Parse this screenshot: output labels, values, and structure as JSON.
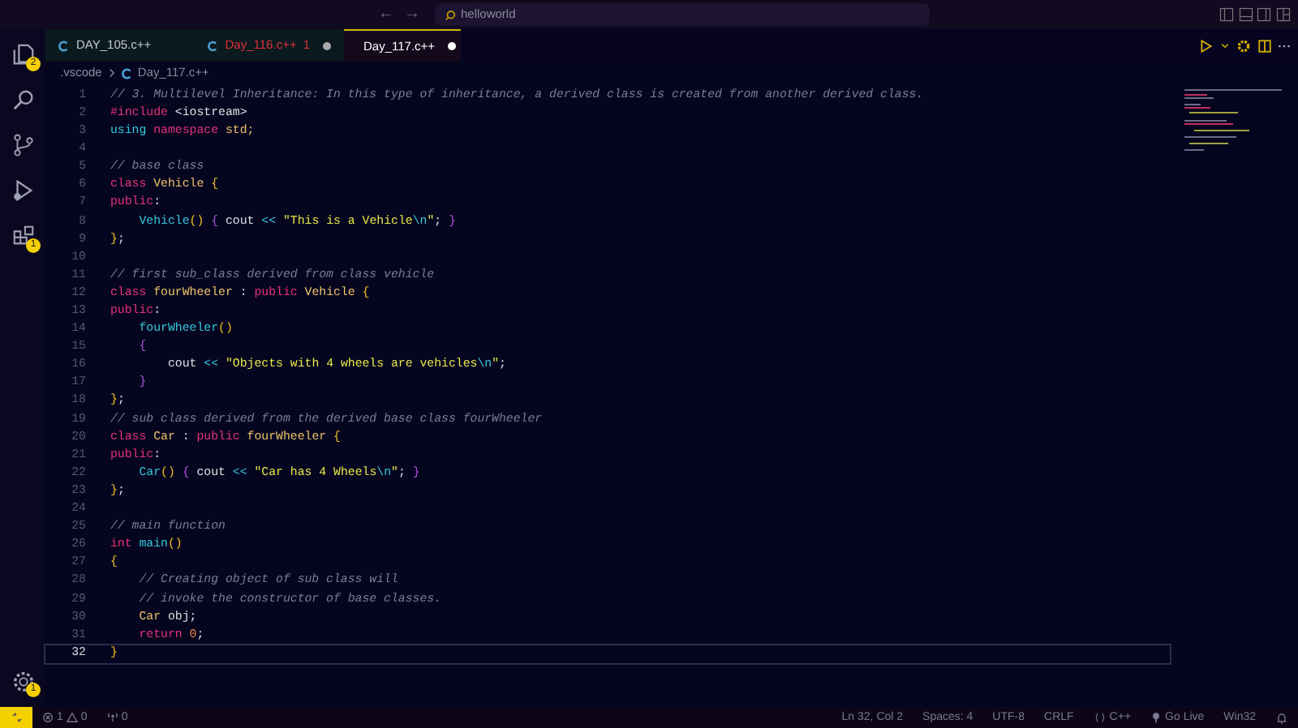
{
  "title_bar": {
    "back": "←",
    "forward": "→",
    "search": "helloworld"
  },
  "activity_bar": {
    "items": [
      {
        "kind": "files",
        "badge": "2"
      },
      {
        "kind": "search"
      },
      {
        "kind": "source"
      },
      {
        "kind": "run"
      },
      {
        "kind": "extensions",
        "badge": "1"
      }
    ],
    "manage": {
      "badge": "1"
    }
  },
  "tabs": [
    {
      "label": "DAY_105.c++",
      "selected": false,
      "modified": false,
      "error": false
    },
    {
      "label": "Day_116.c++",
      "problems": "1",
      "selected": false,
      "modified": true,
      "error": true
    },
    {
      "label": "Day_117.c++",
      "selected": true,
      "modified": true,
      "error": false
    }
  ],
  "breadcrumb": [
    ".vscode",
    "Day_117.c++"
  ],
  "editor": {
    "lines": [
      {
        "number": "1",
        "current": false,
        "tokens": [
          {
            "text": "// 3. Multilevel Inheritance: In this type of inheritance, a derived class is created from another derived class.",
            "kind": "comment"
          }
        ]
      },
      {
        "number": "2",
        "current": false,
        "tokens": [
          {
            "text": "#include",
            "kind": "keyword"
          },
          {
            "text": " <iostream>",
            "kind": "plain"
          }
        ]
      },
      {
        "number": "3",
        "current": false,
        "tokens": [
          {
            "text": "using",
            "kind": "function"
          },
          {
            "text": " namespace",
            "kind": "keyword"
          },
          {
            "text": " std;",
            "kind": "type"
          }
        ]
      },
      {
        "number": "4",
        "current": false
      },
      {
        "number": "5",
        "current": false,
        "tokens": [
          {
            "text": "// base class",
            "kind": "comment"
          }
        ]
      },
      {
        "number": "6",
        "current": false,
        "tokens": [
          {
            "text": "class",
            "kind": "keyword"
          },
          {
            "text": " Vehicle ",
            "kind": "type"
          },
          {
            "text": "{",
            "kind": "bracket"
          }
        ]
      },
      {
        "number": "7",
        "current": false,
        "tokens": [
          {
            "text": "public",
            "kind": "keyword"
          },
          {
            "text": ":",
            "kind": "plain"
          }
        ]
      },
      {
        "number": "8",
        "current": false,
        "tokens": [
          {
            "text": "    Vehicle",
            "kind": "function"
          },
          {
            "text": "()",
            "kind": "bracket"
          },
          {
            "text": " {",
            "kind": "brace"
          },
          {
            "text": " cout ",
            "kind": "plain"
          },
          {
            "text": "<<",
            "kind": "function"
          },
          {
            "text": " \"This is a Vehicle",
            "kind": "string"
          },
          {
            "text": "\\n",
            "kind": "escape"
          },
          {
            "text": "\"",
            "kind": "string"
          },
          {
            "text": ";",
            "kind": "plain"
          },
          {
            "text": " }",
            "kind": "brace"
          }
        ]
      },
      {
        "number": "9",
        "current": false,
        "tokens": [
          {
            "text": "}",
            "kind": "bracket"
          },
          {
            "text": ";",
            "kind": "plain"
          }
        ]
      },
      {
        "number": "10",
        "current": false
      },
      {
        "number": "11",
        "current": false,
        "tokens": [
          {
            "text": "// first sub_class derived from class vehicle",
            "kind": "comment"
          }
        ]
      },
      {
        "number": "12",
        "current": false,
        "tokens": [
          {
            "text": "class",
            "kind": "keyword"
          },
          {
            "text": " fourWheeler ",
            "kind": "type"
          },
          {
            "text": ":",
            "kind": "plain"
          },
          {
            "text": " public",
            "kind": "keyword"
          },
          {
            "text": " Vehicle ",
            "kind": "type"
          },
          {
            "text": "{",
            "kind": "bracket"
          }
        ]
      },
      {
        "number": "13",
        "current": false,
        "tokens": [
          {
            "text": "public",
            "kind": "keyword"
          },
          {
            "text": ":",
            "kind": "plain"
          }
        ]
      },
      {
        "number": "14",
        "current": false,
        "tokens": [
          {
            "text": "    fourWheeler",
            "kind": "function"
          },
          {
            "text": "()",
            "kind": "bracket"
          }
        ]
      },
      {
        "number": "15",
        "current": false,
        "tokens": [
          {
            "text": "    {",
            "kind": "brace"
          }
        ]
      },
      {
        "number": "16",
        "current": false,
        "tokens": [
          {
            "text": "        cout ",
            "kind": "plain"
          },
          {
            "text": "<<",
            "kind": "function"
          },
          {
            "text": " \"Objects with 4 wheels are vehicles",
            "kind": "string"
          },
          {
            "text": "\\n",
            "kind": "escape"
          },
          {
            "text": "\"",
            "kind": "string"
          },
          {
            "text": ";",
            "kind": "plain"
          }
        ]
      },
      {
        "number": "17",
        "current": false,
        "tokens": [
          {
            "text": "    }",
            "kind": "brace"
          }
        ]
      },
      {
        "number": "18",
        "current": false,
        "tokens": [
          {
            "text": "}",
            "kind": "bracket"
          },
          {
            "text": ";",
            "kind": "plain"
          }
        ]
      },
      {
        "number": "19",
        "current": false,
        "tokens": [
          {
            "text": "// sub class derived from the derived base class fourWheeler",
            "kind": "comment"
          }
        ]
      },
      {
        "number": "20",
        "current": false,
        "tokens": [
          {
            "text": "class",
            "kind": "keyword"
          },
          {
            "text": " Car ",
            "kind": "type"
          },
          {
            "text": ":",
            "kind": "plain"
          },
          {
            "text": " public",
            "kind": "keyword"
          },
          {
            "text": " fourWheeler ",
            "kind": "type"
          },
          {
            "text": "{",
            "kind": "bracket"
          }
        ]
      },
      {
        "number": "21",
        "current": false,
        "tokens": [
          {
            "text": "public",
            "kind": "keyword"
          },
          {
            "text": ":",
            "kind": "plain"
          }
        ]
      },
      {
        "number": "22",
        "current": false,
        "tokens": [
          {
            "text": "    Car",
            "kind": "function"
          },
          {
            "text": "()",
            "kind": "bracket"
          },
          {
            "text": " {",
            "kind": "brace"
          },
          {
            "text": " cout ",
            "kind": "plain"
          },
          {
            "text": "<<",
            "kind": "function"
          },
          {
            "text": " \"Car has 4 Wheels",
            "kind": "string"
          },
          {
            "text": "\\n",
            "kind": "escape"
          },
          {
            "text": "\"",
            "kind": "string"
          },
          {
            "text": ";",
            "kind": "plain"
          },
          {
            "text": " }",
            "kind": "brace"
          }
        ]
      },
      {
        "number": "23",
        "current": false,
        "tokens": [
          {
            "text": "}",
            "kind": "bracket"
          },
          {
            "text": ";",
            "kind": "plain"
          }
        ]
      },
      {
        "number": "24",
        "current": false
      },
      {
        "number": "25",
        "current": false,
        "tokens": [
          {
            "text": "// main function",
            "kind": "comment"
          }
        ]
      },
      {
        "number": "26",
        "current": false,
        "tokens": [
          {
            "text": "int",
            "kind": "keyword"
          },
          {
            "text": " main",
            "kind": "function"
          },
          {
            "text": "()",
            "kind": "bracket"
          }
        ]
      },
      {
        "number": "27",
        "current": false,
        "tokens": [
          {
            "text": "{",
            "kind": "bracket"
          }
        ]
      },
      {
        "number": "28",
        "current": false,
        "tokens": [
          {
            "text": "    // Creating object of sub class will",
            "kind": "comment"
          }
        ]
      },
      {
        "number": "29",
        "current": false,
        "tokens": [
          {
            "text": "    // invoke the constructor of base classes.",
            "kind": "comment"
          }
        ]
      },
      {
        "number": "30",
        "current": false,
        "tokens": [
          {
            "text": "    Car",
            "kind": "type"
          },
          {
            "text": " obj;",
            "kind": "plain"
          }
        ]
      },
      {
        "number": "31",
        "current": false,
        "tokens": [
          {
            "text": "    return",
            "kind": "keyword"
          },
          {
            "text": " 0",
            "kind": "number"
          },
          {
            "text": ";",
            "kind": "plain"
          }
        ]
      },
      {
        "number": "32",
        "current": true,
        "tokens": [
          {
            "text": "}",
            "kind": "bracket"
          }
        ]
      }
    ]
  },
  "status_bar": {
    "errors": "1",
    "warnings": "0",
    "ports": "0",
    "items": [
      {
        "kind": "text",
        "text": "Ln 32, Col 2"
      },
      {
        "kind": "text",
        "text": "Spaces: 4"
      },
      {
        "kind": "text",
        "text": "UTF-8"
      },
      {
        "kind": "text",
        "text": "CRLF"
      },
      {
        "kind": "language",
        "text": "C++"
      },
      {
        "kind": "live",
        "text": "Go Live"
      },
      {
        "kind": "text",
        "text": "Win32"
      },
      {
        "kind": "bell"
      }
    ]
  }
}
